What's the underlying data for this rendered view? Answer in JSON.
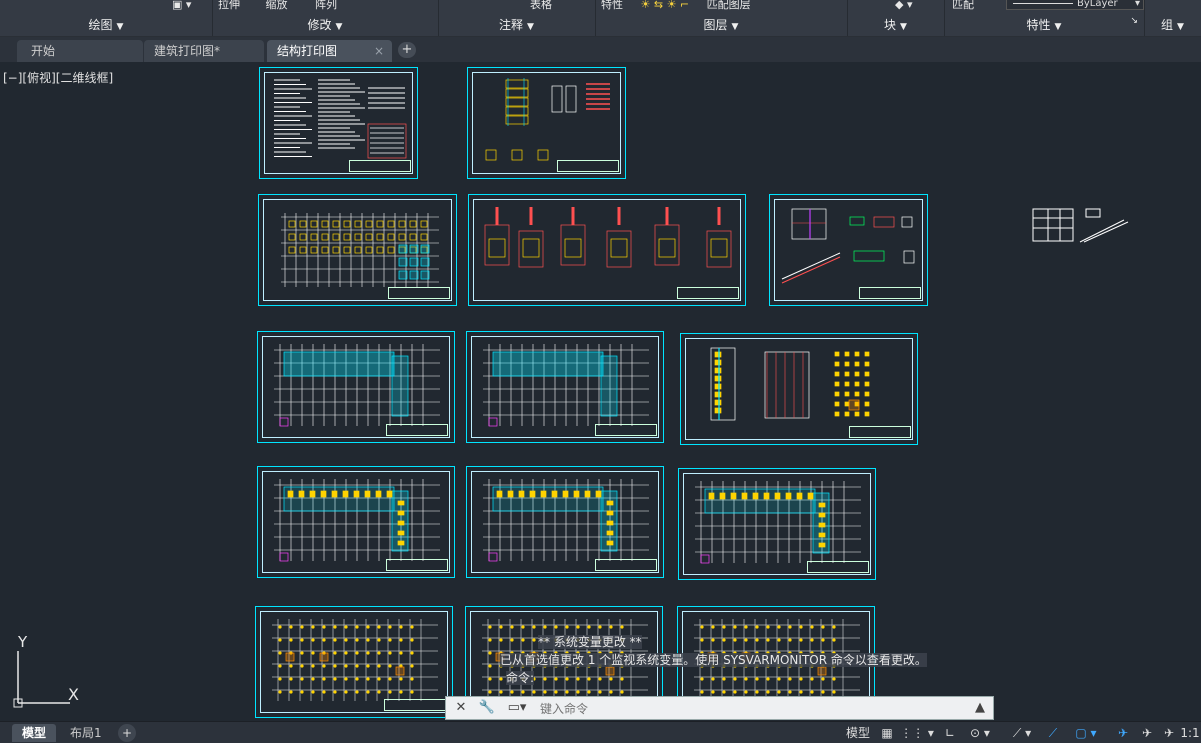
{
  "ribbon": {
    "tools": {
      "draw": "",
      "modify": [
        "拉伸",
        "缩放",
        "阵列"
      ],
      "annotate": "表格",
      "layers": [
        "特性",
        "匹配图层"
      ],
      "props": [
        "匹配",
        "ByLayer"
      ]
    },
    "groups": [
      {
        "label": "绘图"
      },
      {
        "label": "修改"
      },
      {
        "label": "注释"
      },
      {
        "label": "图层"
      },
      {
        "label": "块"
      },
      {
        "label": "特性"
      },
      {
        "label": "组"
      }
    ]
  },
  "tabs": [
    {
      "label": "开始"
    },
    {
      "label": "建筑打印图*"
    },
    {
      "label": "结构打印图"
    }
  ],
  "tab_close_glyph": "×",
  "tab_add_glyph": "+",
  "viewport": {
    "label": "[−][俯视][二维线框]",
    "ucs_y": "Y",
    "ucs_x": "X"
  },
  "command": {
    "history": [
      "** 系统变量更改 **",
      "已从首选值更改 1 个监视系统变量。使用 SYSVARMONITOR 命令以查看更改。",
      "命令:"
    ],
    "placeholder": "键入命令"
  },
  "statusbar": {
    "layouts": [
      {
        "label": "模型"
      },
      {
        "label": "布局1"
      }
    ],
    "add": "+",
    "model_button": "模型",
    "scale": "1:1"
  },
  "colors": {
    "canvas": "#212830",
    "ribbon": "#343a44",
    "frame": "#00e5ff"
  }
}
